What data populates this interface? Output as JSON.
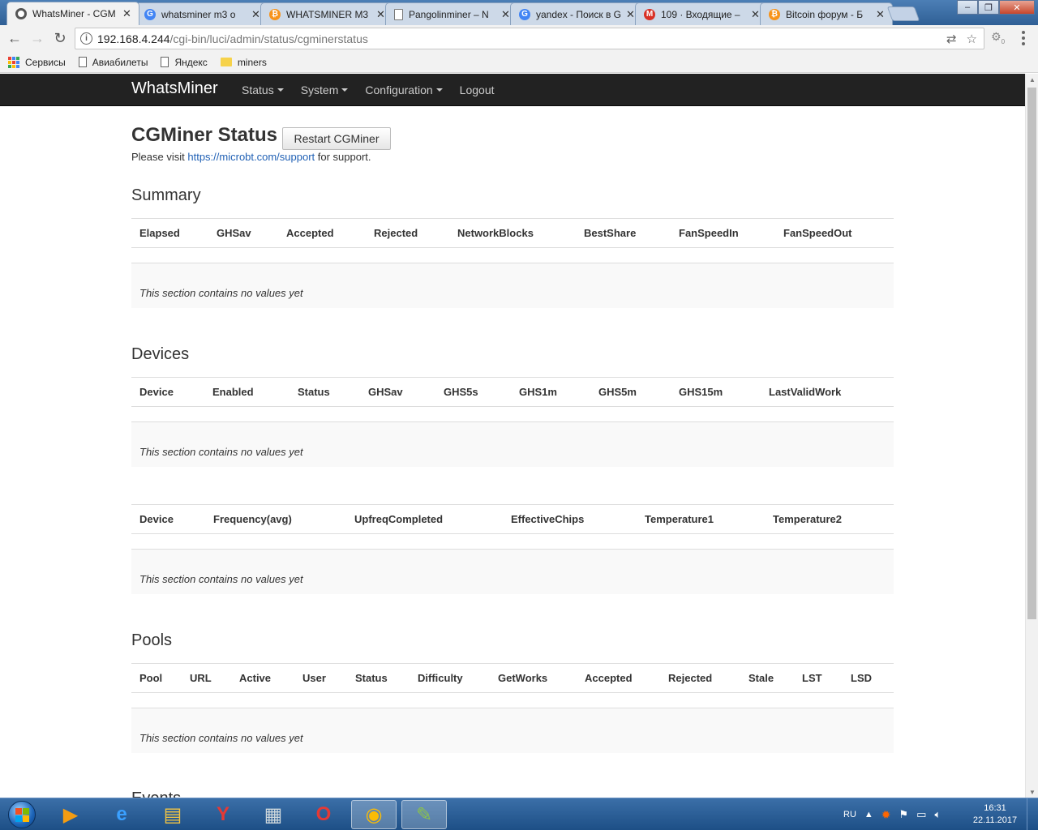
{
  "browser": {
    "tabs": [
      {
        "title": "WhatsMiner - CGM",
        "icon": "spinner-icon",
        "color": "#555555",
        "active": true
      },
      {
        "title": "whatsminer m3 o",
        "icon": "google-icon",
        "color": "#4285f4",
        "active": false
      },
      {
        "title": "WHATSMINER M3",
        "icon": "bitcoin-icon",
        "color": "#f7931a",
        "active": false
      },
      {
        "title": "Pangolinminer – N",
        "icon": "page-icon",
        "color": "#777777",
        "active": false
      },
      {
        "title": "yandex - Поиск в G",
        "icon": "google-icon",
        "color": "#4285f4",
        "active": false
      },
      {
        "title": "109 · Входящие –",
        "icon": "gmail-icon",
        "color": "#d93025",
        "active": false
      },
      {
        "title": "Bitcoin форум - Б",
        "icon": "bitcoin-icon",
        "color": "#f7931a",
        "active": false
      }
    ],
    "url_host": "192.168.4.244",
    "url_path": "/cgi-bin/luci/admin/status/cgminerstatus",
    "extension_badge": "0",
    "bookmarks": [
      {
        "label": "Сервисы",
        "icon": "apps-icon"
      },
      {
        "label": "Авиабилеты",
        "icon": "page-icon"
      },
      {
        "label": "Яндекс",
        "icon": "page-icon"
      },
      {
        "label": "miners",
        "icon": "folder-icon"
      }
    ]
  },
  "site": {
    "brand": "WhatsMiner",
    "nav": [
      {
        "label": "Status",
        "dropdown": true
      },
      {
        "label": "System",
        "dropdown": true
      },
      {
        "label": "Configuration",
        "dropdown": true
      },
      {
        "label": "Logout",
        "dropdown": false
      }
    ]
  },
  "page": {
    "title": "CGMiner Status",
    "restart_label": "Restart CGMiner",
    "support_prefix": "Please visit ",
    "support_link": "https://microbt.com/support",
    "support_suffix": " for support.",
    "empty_text": "This section contains no values yet"
  },
  "sections": {
    "summary": {
      "title": "Summary",
      "columns": [
        "Elapsed",
        "GHSav",
        "Accepted",
        "Rejected",
        "NetworkBlocks",
        "BestShare",
        "FanSpeedIn",
        "FanSpeedOut"
      ]
    },
    "devices": {
      "title": "Devices",
      "columns": [
        "Device",
        "Enabled",
        "Status",
        "GHSav",
        "GHS5s",
        "GHS1m",
        "GHS5m",
        "GHS15m",
        "LastValidWork"
      ]
    },
    "devices2": {
      "columns": [
        "Device",
        "Frequency(avg)",
        "UpfreqCompleted",
        "EffectiveChips",
        "Temperature1",
        "Temperature2"
      ]
    },
    "pools": {
      "title": "Pools",
      "columns": [
        "Pool",
        "URL",
        "Active",
        "User",
        "Status",
        "Difficulty",
        "GetWorks",
        "Accepted",
        "Rejected",
        "Stale",
        "LST",
        "LSD"
      ]
    },
    "events": {
      "title": "Events"
    }
  },
  "taskbar": {
    "lang": "RU",
    "time": "16:31",
    "date": "22.11.2017",
    "apps": [
      "media-player-icon",
      "ie-icon",
      "explorer-icon",
      "yandex-browser-icon",
      "calculator-icon",
      "opera-icon",
      "chrome-icon",
      "paint-icon"
    ]
  }
}
